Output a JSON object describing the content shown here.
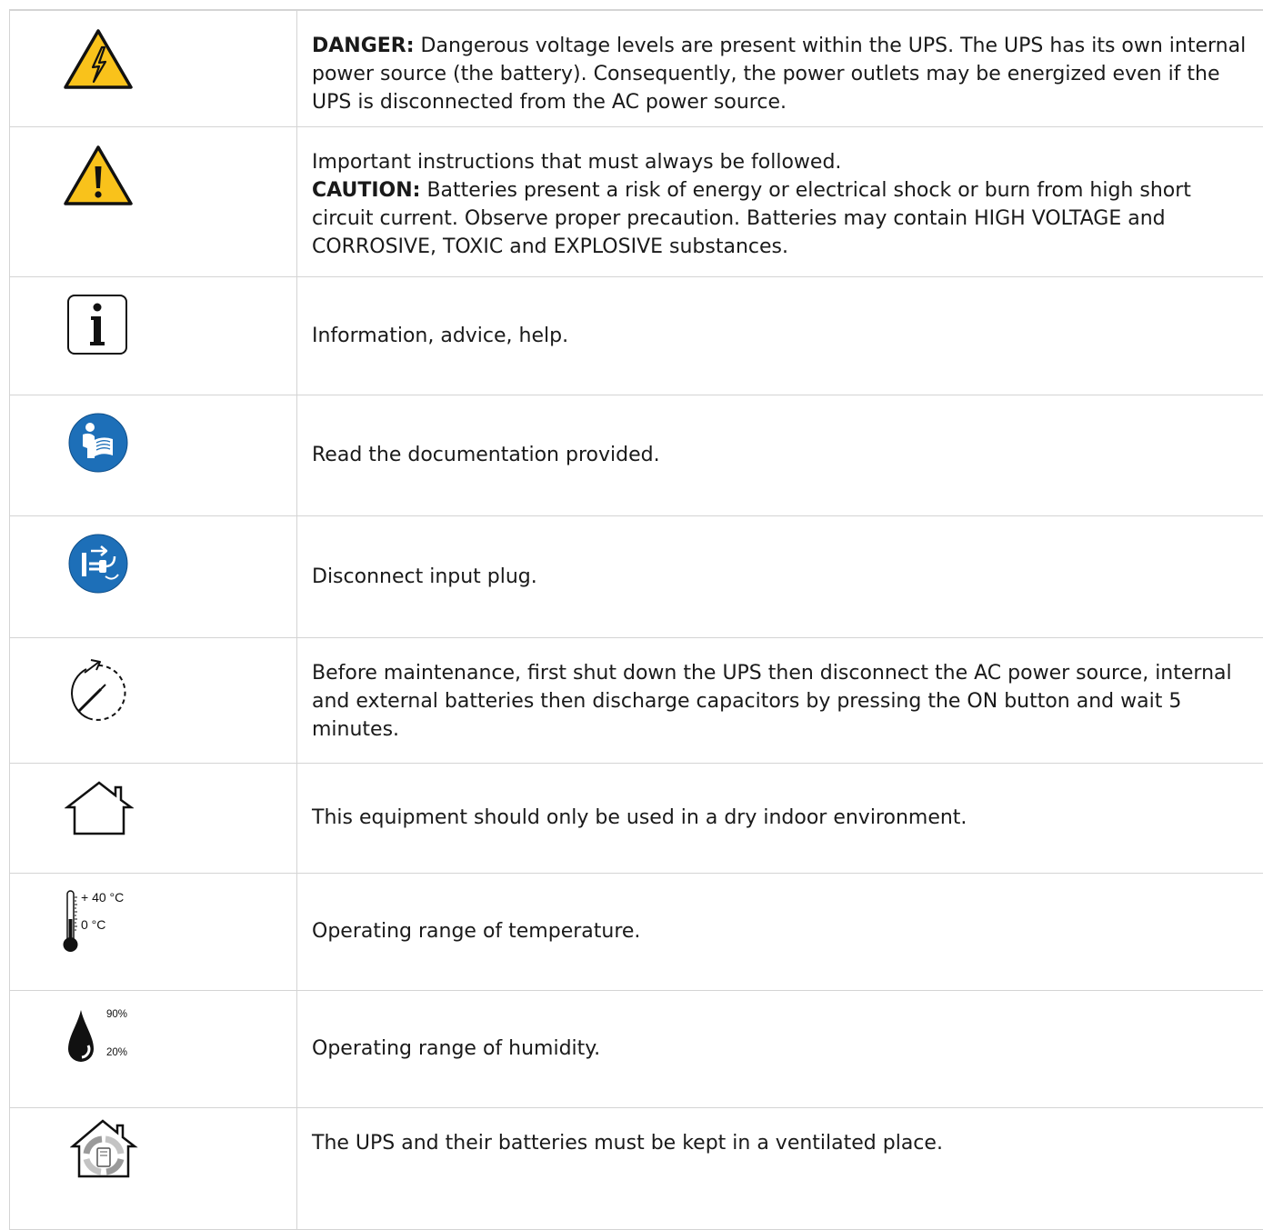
{
  "rows": [
    {
      "id": "danger-voltage",
      "icon": "high-voltage-warning-icon",
      "keyword": "DANGER:",
      "text": " Dangerous voltage levels are present within the UPS. The UPS has its own internal power source (the battery). Consequently, the power outlets may be energized even if the UPS is disconnected from the AC power source."
    },
    {
      "id": "caution-battery",
      "icon": "general-warning-icon",
      "intro": "Important instructions that must always be followed.",
      "keyword": "CAUTION:",
      "text": " Batteries present a risk of energy or electrical shock or burn from high short circuit current. Observe proper precaution. Batteries may contain HIGH VOLTAGE and CORROSIVE, TOXIC and EXPLOSIVE substances."
    },
    {
      "id": "information",
      "icon": "information-icon",
      "text": "Information, advice, help."
    },
    {
      "id": "read-documentation",
      "icon": "read-manual-icon",
      "text": "Read the documentation provided."
    },
    {
      "id": "disconnect-plug",
      "icon": "disconnect-plug-icon",
      "text": "Disconnect input plug."
    },
    {
      "id": "maintenance",
      "icon": "discharge-wait-icon",
      "text": "Before maintenance, first shut down the UPS then disconnect the AC power source, internal and external batteries then discharge capacitors by pressing the ON button and wait 5 minutes."
    },
    {
      "id": "indoor-use",
      "icon": "indoor-house-icon",
      "text": "This equipment should only be used in a dry indoor environment."
    },
    {
      "id": "temperature",
      "icon": "thermometer-icon",
      "temp_max": "+ 40 °C",
      "temp_min": "0 °C",
      "text": "Operating range of temperature."
    },
    {
      "id": "humidity",
      "icon": "humidity-drop-icon",
      "humidity_max": "90%",
      "humidity_min": "20%",
      "text": "Operating range of humidity."
    },
    {
      "id": "ventilation",
      "icon": "ventilated-house-icon",
      "text": "The UPS and their batteries must be kept in a ventilated place."
    }
  ],
  "colors": {
    "warning_yellow": "#f9c21b",
    "mandatory_blue": "#1d6fb8",
    "border_gray": "#d4d4d4"
  }
}
